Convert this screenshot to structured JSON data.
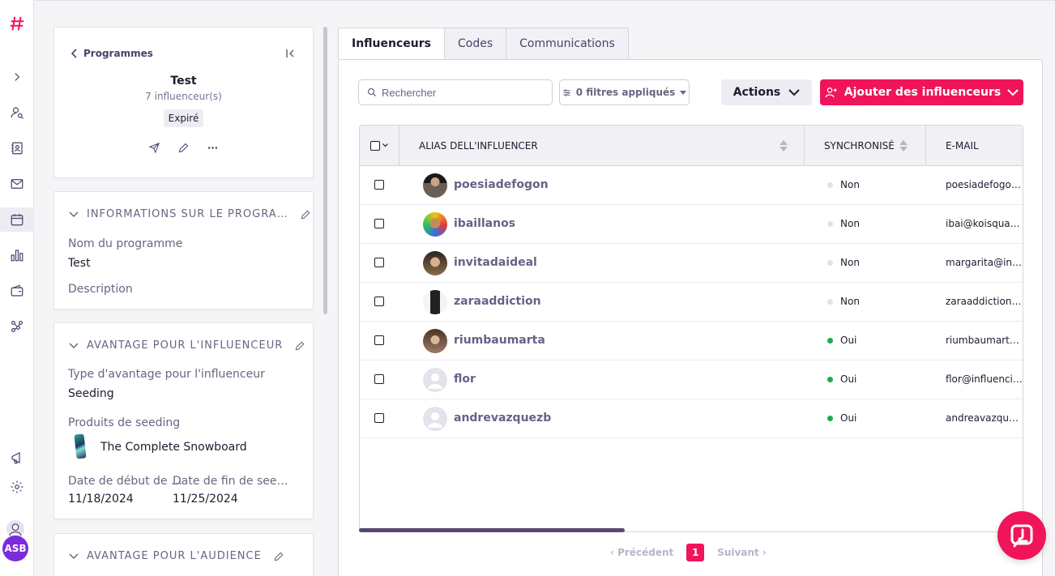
{
  "program": {
    "back_label": "Programmes",
    "title": "Test",
    "count": "7 influenceur(s)",
    "status": "Expiré"
  },
  "info_section": {
    "heading": "INFORMATIONS SUR LE PROGRA…",
    "name_label": "Nom du programme",
    "name_value": "Test",
    "description_label": "Description"
  },
  "influencer_benefit": {
    "heading": "AVANTAGE POUR L'INFLUENCEUR",
    "type_label": "Type d'avantage pour l'influenceur",
    "type_value": "Seeding",
    "products_label": "Produits de seeding",
    "product_name": "The Complete Snowboard",
    "start_label": "Date de début de …",
    "start_value": "11/18/2024",
    "end_label": "Date de fin de see…",
    "end_value": "11/25/2024"
  },
  "audience_benefit": {
    "heading": "AVANTAGE POUR L'AUDIENCE"
  },
  "tabs": [
    "Influenceurs",
    "Codes",
    "Communications"
  ],
  "toolbar": {
    "search_placeholder": "Rechercher",
    "filters_label": "0 filtres appliqués",
    "actions_label": "Actions",
    "add_label": "Ajouter des influenceurs"
  },
  "table": {
    "columns": [
      "ALIAS DELL'INFLUENCER",
      "SYNCHRONISÉ",
      "E-MAIL"
    ],
    "rows": [
      {
        "alias": "poesiadefogon",
        "sync": "Non",
        "email": "poesiadefogon..."
      },
      {
        "alias": "ibaillanos",
        "sync": "Non",
        "email": "ibai@koisquad..."
      },
      {
        "alias": "invitadaideal",
        "sync": "Non",
        "email": "margarita@invi..."
      },
      {
        "alias": "zaraaddiction",
        "sync": "Non",
        "email": "zaraaddiction@..."
      },
      {
        "alias": "riumbaumarta",
        "sync": "Oui",
        "email": "riumbaumartai..."
      },
      {
        "alias": "flor",
        "sync": "Oui",
        "email": "flor@influencit..."
      },
      {
        "alias": "andrevazquezb",
        "sync": "Oui",
        "email": "andreavazquez..."
      }
    ]
  },
  "pagination": {
    "prev": "Précédent",
    "current": "1",
    "next": "Suivant"
  },
  "user": {
    "initials": "ASB"
  },
  "colors": {
    "accent": "#f0145a",
    "sync_yes": "#1faa55",
    "sync_no": "#e2e0e8"
  }
}
